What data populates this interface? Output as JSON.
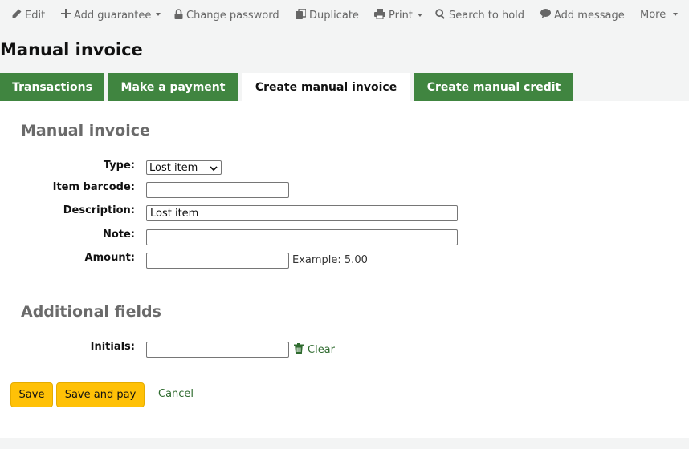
{
  "toolbar": {
    "edit": "Edit",
    "add_guarantee": "Add guarantee",
    "change_password": "Change password",
    "duplicate": "Duplicate",
    "print": "Print",
    "search_to_hold": "Search to hold",
    "add_message": "Add message",
    "more": "More"
  },
  "page_title": "Manual invoice",
  "tabs": [
    {
      "label": "Transactions"
    },
    {
      "label": "Make a payment"
    },
    {
      "label": "Create manual invoice",
      "active": true
    },
    {
      "label": "Create manual credit"
    }
  ],
  "form": {
    "section_title": "Manual invoice",
    "type": {
      "label": "Type:",
      "selected": "Lost item"
    },
    "item_barcode": {
      "label": "Item barcode:",
      "value": ""
    },
    "description": {
      "label": "Description:",
      "value": "Lost item"
    },
    "note": {
      "label": "Note:",
      "value": ""
    },
    "amount": {
      "label": "Amount:",
      "value": "",
      "hint": "Example: 5.00"
    }
  },
  "additional": {
    "section_title": "Additional fields",
    "initials": {
      "label": "Initials:",
      "value": ""
    },
    "clear_label": "Clear"
  },
  "actions": {
    "save": "Save",
    "save_and_pay": "Save and pay",
    "cancel": "Cancel"
  },
  "colors": {
    "tab_green": "#408540",
    "button_yellow": "#ffc107",
    "link_green": "#2f6b2f"
  }
}
